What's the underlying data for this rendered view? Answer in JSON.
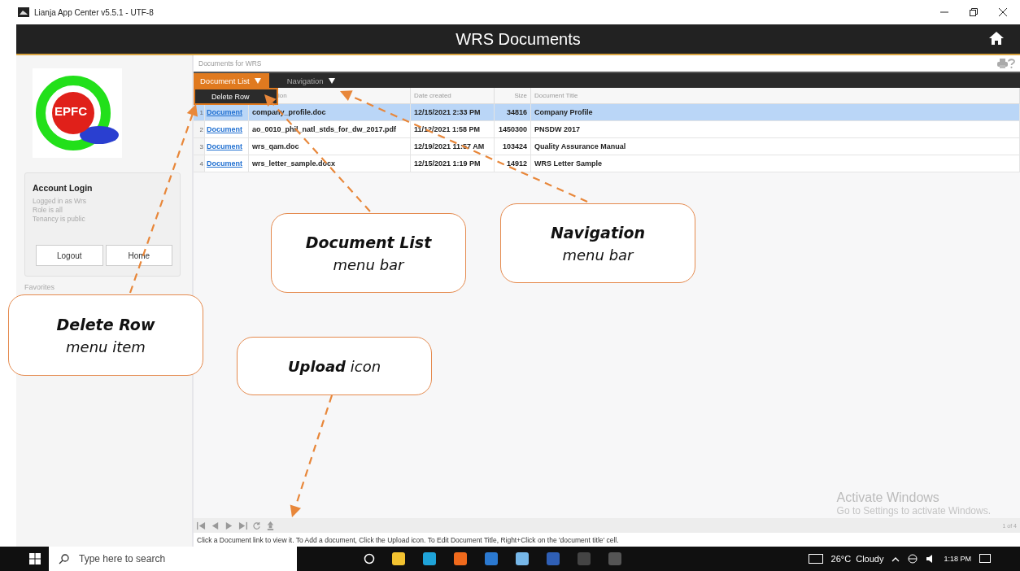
{
  "window": {
    "title": "Lianja App Center v5.5.1 - UTF-8"
  },
  "app_header": {
    "title": "WRS Documents"
  },
  "sidebar": {
    "logo_text": "EPFC",
    "account": {
      "title": "Account Login",
      "lines": [
        "Logged in as Wrs",
        "Role is all",
        "Tenancy is public"
      ],
      "buttons": [
        "Logout",
        "Home"
      ]
    },
    "favorites_title": "Favorites"
  },
  "page": {
    "title": "Documents for WRS",
    "menus": [
      {
        "label": "Document List",
        "selected": true
      },
      {
        "label": "Navigation",
        "selected": false
      }
    ],
    "dropdown": {
      "items": [
        "Delete Row"
      ]
    },
    "table": {
      "columns": [
        "ion",
        "Date created",
        "Size",
        "Document Title"
      ],
      "rows": [
        {
          "number": "1",
          "link": "Document",
          "file": "company_profile.doc",
          "date": "12/15/2021 2:33 PM",
          "size": "34816",
          "title": "Company Profile",
          "selected": true
        },
        {
          "number": "2",
          "link": "Document",
          "file": "ao_0010_phil_natl_stds_for_dw_2017.pdf",
          "date": "11/12/2021 1:58 PM",
          "size": "1450300",
          "title": "PNSDW 2017",
          "selected": false
        },
        {
          "number": "3",
          "link": "Document",
          "file": "wrs_qam.doc",
          "date": "12/19/2021 11:57 AM",
          "size": "103424",
          "title": "Quality Assurance Manual",
          "selected": false
        },
        {
          "number": "4",
          "link": "Document",
          "file": "wrs_letter_sample.docx",
          "date": "12/15/2021 1:19 PM",
          "size": "14912",
          "title": "WRS Letter Sample",
          "selected": false
        }
      ]
    },
    "page_info": "1 of 4",
    "status": "Click a Document link to view it. To Add a document, Click the Upload icon. To Edit Document Title, Right+Click on the 'document title' cell."
  },
  "watermark": {
    "title": "Activate Windows",
    "subtitle": "Go to Settings to activate Windows."
  },
  "taskbar": {
    "search_placeholder": "Type here to search",
    "weather": "26°C  Cloudy",
    "time": "1:18 PM"
  },
  "annotations": [
    {
      "kind": "two_line",
      "title": "Delete Row",
      "subtitle": "menu item"
    },
    {
      "kind": "two_line",
      "title": "Document List",
      "subtitle": "menu bar"
    },
    {
      "kind": "two_line",
      "title": "Navigation",
      "subtitle": "menu bar"
    },
    {
      "kind": "one_line",
      "text": "**Upload** icon"
    }
  ]
}
